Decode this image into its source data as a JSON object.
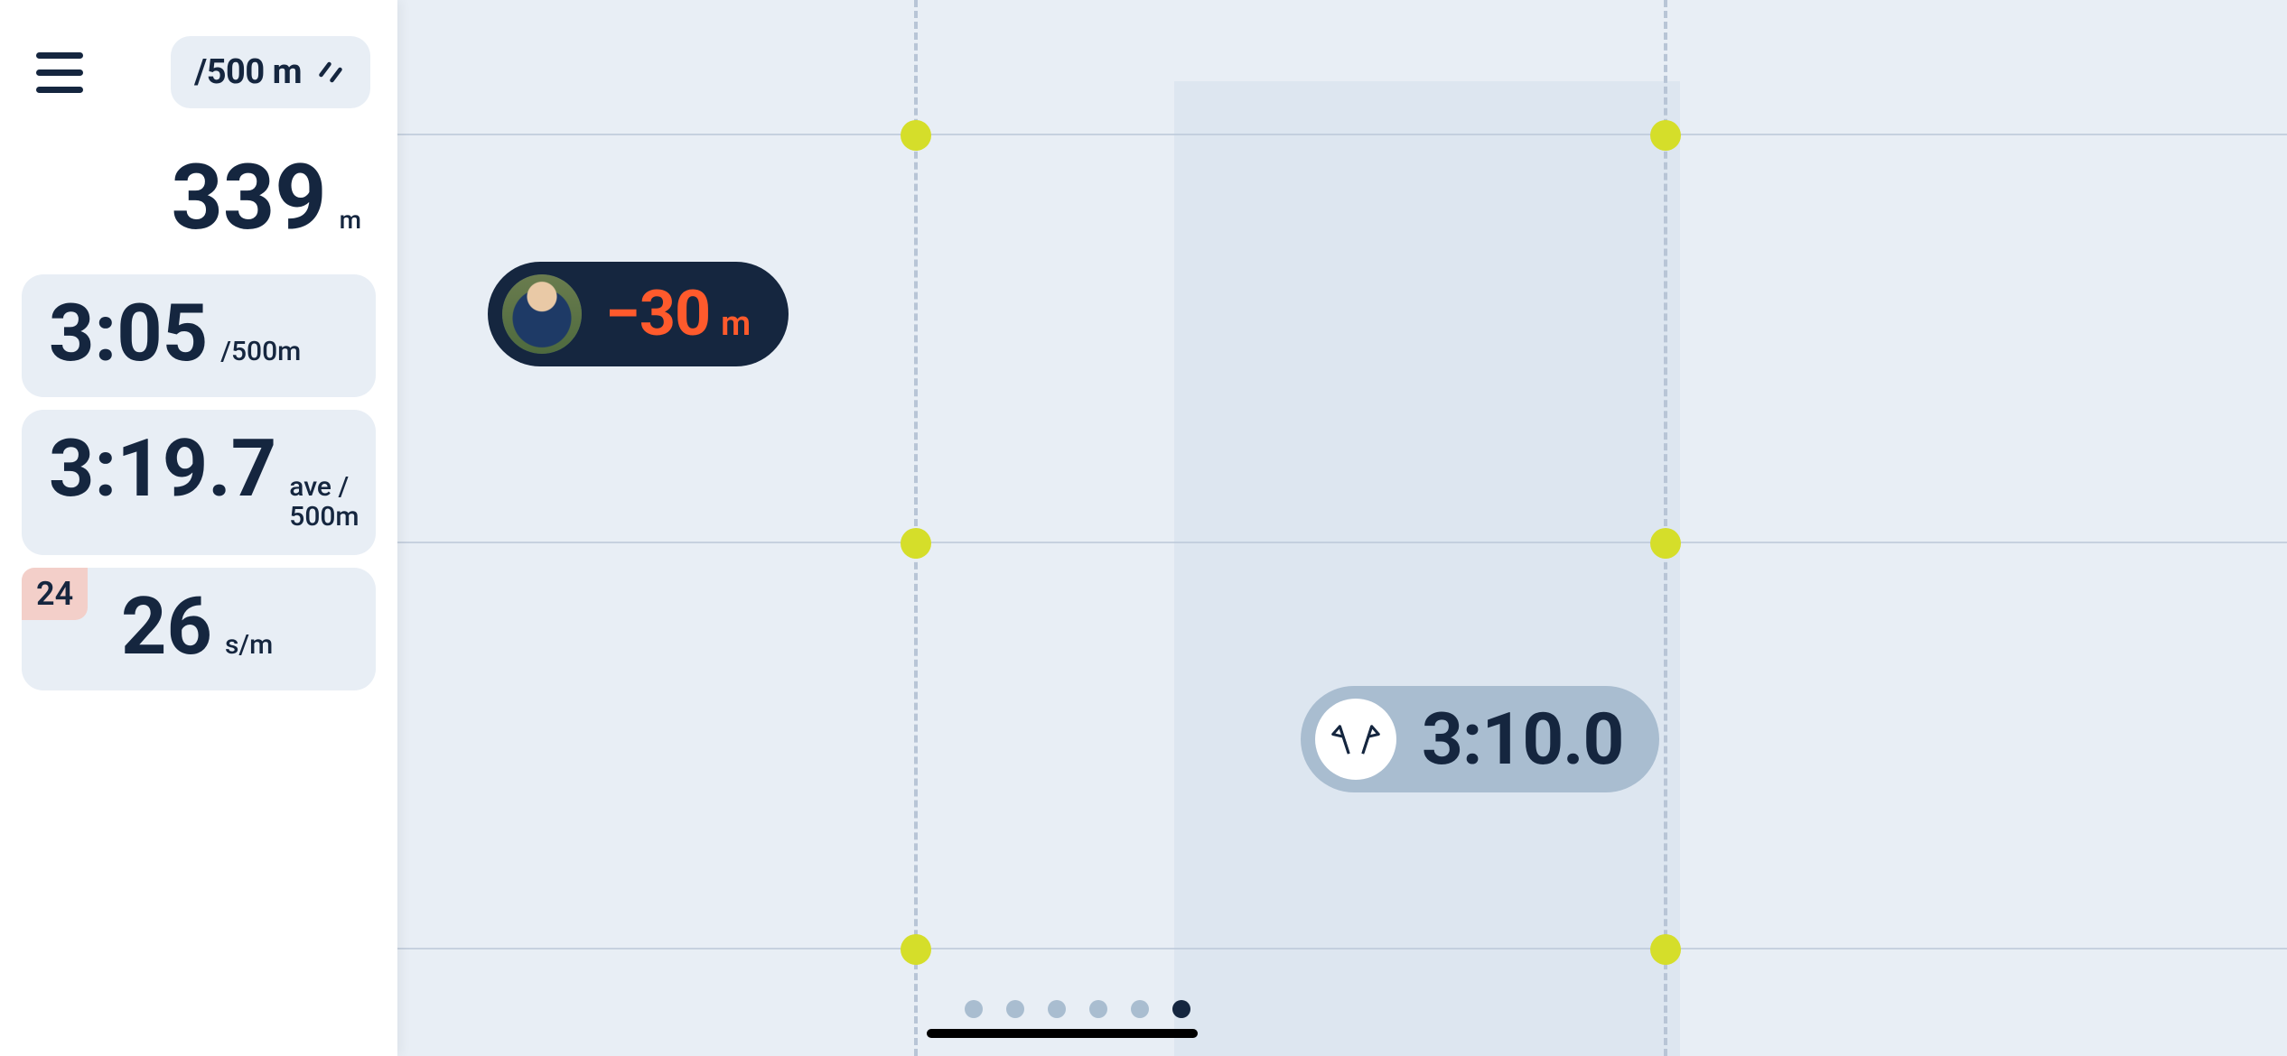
{
  "sidebar": {
    "mode": {
      "label": "/500 m"
    },
    "distance": {
      "value": "339",
      "unit": "m"
    },
    "pace": {
      "value": "3:05",
      "unit": "/500m"
    },
    "avg_pace": {
      "value": "3:19.7",
      "unit": "ave / 500m"
    },
    "stroke_rate": {
      "value": "26",
      "unit": "s/m",
      "target_badge": "24"
    }
  },
  "track": {
    "competitor": {
      "diff_value": "−30",
      "diff_unit": "m"
    },
    "target": {
      "value": "3:10.0"
    },
    "pages": {
      "count": 6,
      "active_index": 5
    }
  },
  "colors": {
    "navy": "#15263f",
    "accent": "#ff5a2c",
    "lime": "#d5de2a",
    "bg": "#e8eef5"
  }
}
